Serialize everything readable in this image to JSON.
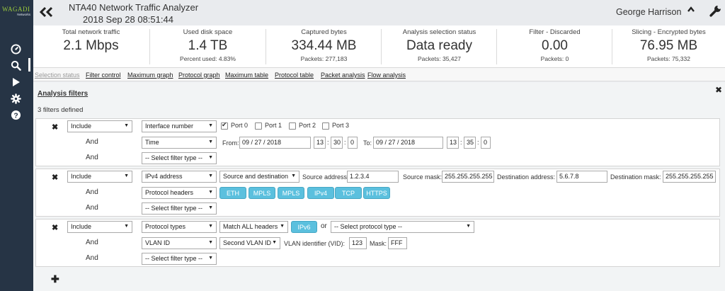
{
  "logo": {
    "line1": "WAGADI",
    "line2": "Networks"
  },
  "header": {
    "title": "NTA40 Network Traffic Analyzer",
    "datetime": "2018 Sep 28 08:51:44",
    "user": "George Harrison"
  },
  "stats": [
    {
      "label": "Total network traffic",
      "value": "2.1 Mbps",
      "sub": ""
    },
    {
      "label": "Used disk space",
      "value": "1.4 TB",
      "sub": "Percent used: 4.83%"
    },
    {
      "label": "Captured bytes",
      "value": "334.44 MB",
      "sub": "Packets: 277,183"
    },
    {
      "label": "Analysis selection status",
      "value": "Data ready",
      "sub": "Packets: 35,427"
    },
    {
      "label": "Filter - Discarded",
      "value": "0.00",
      "sub": "Packets: 0"
    },
    {
      "label": "Slicing - Encrypted bytes",
      "value": "76.95 MB",
      "sub": "Packets: 75,332"
    }
  ],
  "tabs": [
    "Selection status",
    "Filter control",
    "Maximum graph",
    "Protocol graph",
    "Maximum table",
    "Protocol table",
    "Packet analysis",
    "Flow analysis"
  ],
  "panel": {
    "title": "Analysis filters",
    "defined": "3 filters defined"
  },
  "f1": {
    "mode": "Include",
    "type": "Interface number",
    "ports": [
      {
        "label": "Port 0",
        "checked": true
      },
      {
        "label": "Port 1",
        "checked": false
      },
      {
        "label": "Port 2",
        "checked": false
      },
      {
        "label": "Port 3",
        "checked": false
      }
    ],
    "and": "And",
    "and2": "And",
    "time_type": "Time",
    "from_label": "From:",
    "from_date": "09 / 27 / 2018",
    "from_h": "13",
    "from_m": "30",
    "from_s": "0",
    "to_label": "To:",
    "to_date": "09 / 27 / 2018",
    "to_h": "13",
    "to_m": "35",
    "to_s": "0",
    "select_type": "-- Select filter type --"
  },
  "f2": {
    "mode": "Include",
    "type": "IPv4 address",
    "direction": "Source and destination",
    "src_label": "Source address:",
    "src": "1.2.3.4",
    "srcmask_label": "Source mask:",
    "srcmask": "255.255.255.255",
    "dst_label": "Destination address:",
    "dst": "5.6.7.8",
    "dstmask_label": "Destination mask:",
    "dstmask": "255.255.255.255",
    "and": "And",
    "and2": "And",
    "proto_type": "Protocol headers",
    "chips": [
      "ETH",
      "MPLS",
      "MPLS",
      "IPv4",
      "TCP",
      "HTTPS"
    ],
    "select_type": "-- Select filter type --"
  },
  "f3": {
    "mode": "Include",
    "type": "Protocol types",
    "match": "Match ALL headers",
    "chip": "IPv6",
    "or": "or",
    "proto_select": "-- Select protocol type --",
    "and": "And",
    "and2": "And",
    "vlan_type": "VLAN ID",
    "vlan_which": "Second VLAN ID",
    "vid_label": "VLAN identifier (VID):",
    "vid": "123",
    "mask_label": "Mask:",
    "mask": "FFF",
    "select_type": "-- Select filter type --"
  },
  "colors": {
    "sidebar": "#263445",
    "accent": "#5bc0de",
    "logo": "#9ccc3c"
  },
  "icons": [
    "back-icon",
    "dashboard-icon",
    "search-icon",
    "play-icon",
    "gear-icon",
    "help-icon",
    "caret-up-icon",
    "wrench-icon",
    "close-icon",
    "remove-icon",
    "add-icon"
  ]
}
